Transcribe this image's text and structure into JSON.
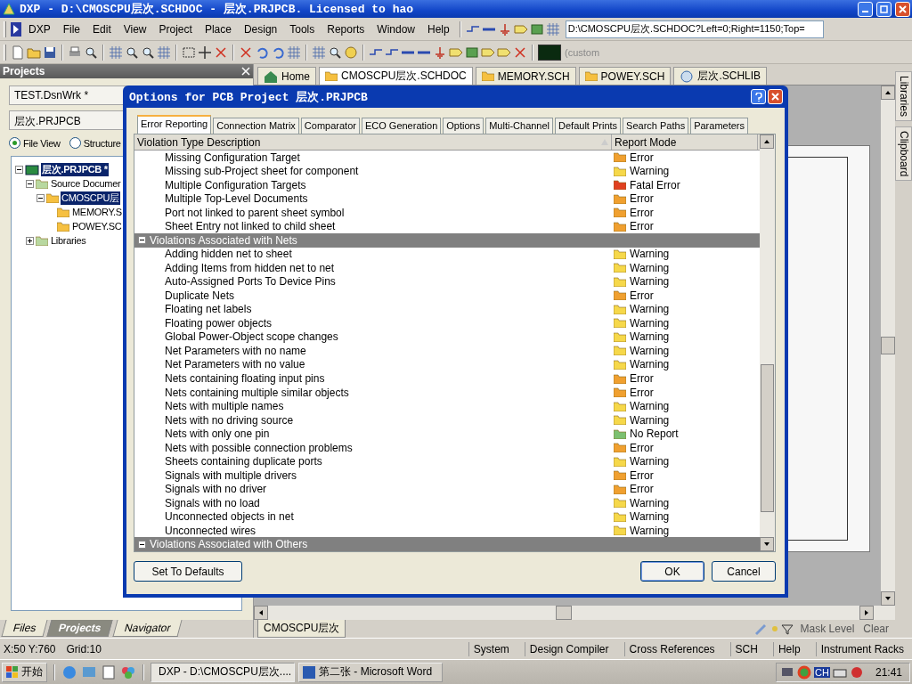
{
  "window": {
    "title": "DXP - D:\\CMOSCPU层次.SCHDOC - 层次.PRJPCB. Licensed to hao"
  },
  "menu": [
    "DXP",
    "File",
    "Edit",
    "View",
    "Project",
    "Place",
    "Design",
    "Tools",
    "Reports",
    "Window",
    "Help"
  ],
  "address_field": {
    "value": "D:\\CMOSCPU层次.SCHDOC?Left=0;Right=1150;Top="
  },
  "color_combo": {
    "value": "(custom"
  },
  "projects_panel": {
    "title": "Projects",
    "workspace_field": {
      "value": "TEST.DsnWrk *"
    },
    "project_field": {
      "value": "层次.PRJPCB"
    },
    "views": [
      {
        "label": "File View",
        "selected": true
      },
      {
        "label": "Structure",
        "selected": false
      }
    ],
    "tree": [
      {
        "label": "层次.PRJPCB *",
        "kind": "project",
        "selected": true,
        "expanded": true,
        "children": [
          {
            "label": "Source Documer",
            "kind": "folder",
            "selected": false,
            "expanded": true,
            "children": [
              {
                "label": "CMOSCPU层",
                "kind": "doc",
                "selected": true,
                "expanded": true,
                "children": [
                  {
                    "label": "MEMORY.S",
                    "kind": "doc",
                    "selected": false
                  },
                  {
                    "label": "POWEY.SC",
                    "kind": "doc",
                    "selected": false
                  }
                ]
              }
            ]
          },
          {
            "label": "Libraries",
            "kind": "folder",
            "selected": false,
            "expanded": false
          }
        ]
      }
    ],
    "tabs": [
      {
        "label": "Files",
        "selected": false
      },
      {
        "label": "Projects",
        "selected": true
      },
      {
        "label": "Navigator",
        "selected": false
      }
    ]
  },
  "document_tabs": [
    {
      "label": "Home",
      "kind": "home",
      "selected": false
    },
    {
      "label": "CMOSCPU层次.SCHDOC",
      "kind": "sch",
      "selected": true
    },
    {
      "label": "MEMORY.SCH",
      "kind": "sch",
      "selected": false
    },
    {
      "label": "POWEY.SCH",
      "kind": "sch",
      "selected": false
    },
    {
      "label": "层次.SCHLIB",
      "kind": "lib",
      "selected": false
    }
  ],
  "sheet_tab": "CMOSCPU层次",
  "mask": {
    "label": "Mask Level",
    "clear": "Clear"
  },
  "side_tabs": [
    "Libraries",
    "Clipboard"
  ],
  "dialog": {
    "title": "Options for PCB Project 层次.PRJPCB",
    "tabs": [
      {
        "label": "Error Reporting",
        "selected": true
      },
      {
        "label": "Connection Matrix",
        "selected": false
      },
      {
        "label": "Comparator",
        "selected": false
      },
      {
        "label": "ECO Generation",
        "selected": false
      },
      {
        "label": "Options",
        "selected": false
      },
      {
        "label": "Multi-Channel",
        "selected": false
      },
      {
        "label": "Default Prints",
        "selected": false
      },
      {
        "label": "Search Paths",
        "selected": false
      },
      {
        "label": "Parameters",
        "selected": false
      }
    ],
    "columns": [
      "Violation Type Description",
      "Report Mode"
    ],
    "rows": [
      {
        "kind": "item",
        "text": "Missing Configuration Target",
        "mode": "Error",
        "color": "#f0a030"
      },
      {
        "kind": "item",
        "text": "Missing sub-Project sheet for component",
        "mode": "Warning",
        "color": "#f6d84a"
      },
      {
        "kind": "item",
        "text": "Multiple Configuration Targets",
        "mode": "Fatal Error",
        "color": "#e04020"
      },
      {
        "kind": "item",
        "text": "Multiple Top-Level Documents",
        "mode": "Error",
        "color": "#f0a030"
      },
      {
        "kind": "item",
        "text": "Port not linked to parent sheet symbol",
        "mode": "Error",
        "color": "#f0a030"
      },
      {
        "kind": "item",
        "text": "Sheet Entry not linked to child sheet",
        "mode": "Error",
        "color": "#f0a030"
      },
      {
        "kind": "group",
        "text": "Violations Associated with Nets",
        "expanded": true
      },
      {
        "kind": "item",
        "text": "Adding hidden net to sheet",
        "mode": "Warning",
        "color": "#f6d84a"
      },
      {
        "kind": "item",
        "text": "Adding Items from hidden net to net",
        "mode": "Warning",
        "color": "#f6d84a"
      },
      {
        "kind": "item",
        "text": "Auto-Assigned Ports To Device Pins",
        "mode": "Warning",
        "color": "#f6d84a"
      },
      {
        "kind": "item",
        "text": "Duplicate Nets",
        "mode": "Error",
        "color": "#f0a030"
      },
      {
        "kind": "item",
        "text": "Floating net labels",
        "mode": "Warning",
        "color": "#f6d84a"
      },
      {
        "kind": "item",
        "text": "Floating power objects",
        "mode": "Warning",
        "color": "#f6d84a"
      },
      {
        "kind": "item",
        "text": "Global Power-Object scope changes",
        "mode": "Warning",
        "color": "#f6d84a"
      },
      {
        "kind": "item",
        "text": "Net Parameters with no name",
        "mode": "Warning",
        "color": "#f6d84a"
      },
      {
        "kind": "item",
        "text": "Net Parameters with no value",
        "mode": "Warning",
        "color": "#f6d84a"
      },
      {
        "kind": "item",
        "text": "Nets containing floating input pins",
        "mode": "Error",
        "color": "#f0a030"
      },
      {
        "kind": "item",
        "text": "Nets containing multiple similar objects",
        "mode": "Error",
        "color": "#f0a030"
      },
      {
        "kind": "item",
        "text": "Nets with multiple names",
        "mode": "Warning",
        "color": "#f6d84a"
      },
      {
        "kind": "item",
        "text": "Nets with no driving source",
        "mode": "Warning",
        "color": "#f6d84a"
      },
      {
        "kind": "item",
        "text": "Nets with only one pin",
        "mode": "No Report",
        "color": "#7cc070"
      },
      {
        "kind": "item",
        "text": "Nets with possible connection problems",
        "mode": "Error",
        "color": "#f0a030"
      },
      {
        "kind": "item",
        "text": "Sheets containing duplicate ports",
        "mode": "Warning",
        "color": "#f6d84a"
      },
      {
        "kind": "item",
        "text": "Signals with multiple drivers",
        "mode": "Error",
        "color": "#f0a030"
      },
      {
        "kind": "item",
        "text": "Signals with no driver",
        "mode": "Error",
        "color": "#f0a030"
      },
      {
        "kind": "item",
        "text": "Signals with no load",
        "mode": "Warning",
        "color": "#f6d84a"
      },
      {
        "kind": "item",
        "text": "Unconnected objects in net",
        "mode": "Warning",
        "color": "#f6d84a"
      },
      {
        "kind": "item",
        "text": "Unconnected wires",
        "mode": "Warning",
        "color": "#f6d84a"
      },
      {
        "kind": "group",
        "text": "Violations Associated with Others",
        "expanded": true
      }
    ],
    "buttons": [
      {
        "label": "Set To Defaults",
        "kind": "left"
      },
      {
        "label": "OK",
        "kind": "default"
      },
      {
        "label": "Cancel",
        "kind": "normal"
      }
    ]
  },
  "status_bar": {
    "coords": "X:50 Y:760",
    "grid": "Grid:10",
    "buttons": [
      "System",
      "Design Compiler",
      "Cross References",
      "SCH",
      "Help",
      "Instrument Racks"
    ]
  },
  "taskbar": {
    "start": "开始",
    "tasks": [
      {
        "label": "DXP - D:\\CMOSCPU层次....",
        "kind": "dxp",
        "selected": true
      },
      {
        "label": "第二张 - Microsoft Word",
        "kind": "word",
        "selected": false
      }
    ],
    "lang": "CH",
    "clock": "21:41"
  }
}
